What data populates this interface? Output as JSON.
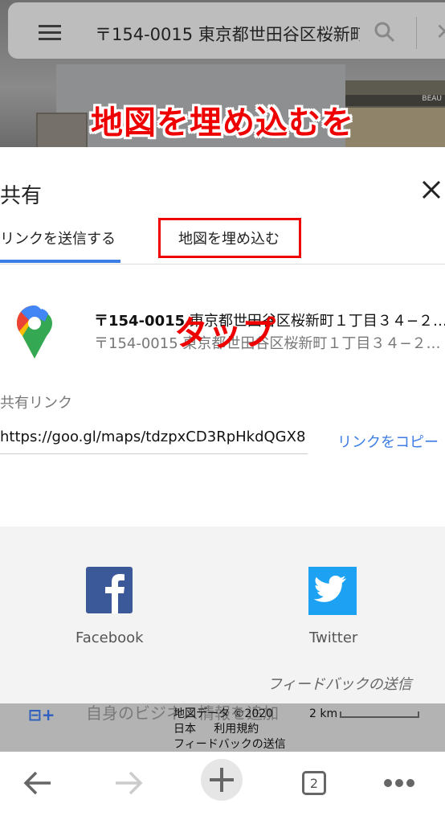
{
  "search_bar": {
    "query": "〒154-0015 東京都世田谷区桜新町",
    "icons": [
      "menu-icon",
      "search-icon",
      "close-icon"
    ]
  },
  "background": {
    "shop_sign": "BEAU"
  },
  "annotations": {
    "line1": "地図を埋め込むを",
    "line2": "タップ",
    "highlight_color": "#ee0000"
  },
  "share_sheet": {
    "title": "共有",
    "close_icon": "close-icon",
    "tabs": [
      {
        "label": "リンクを送信する",
        "active": true
      },
      {
        "label": "地図を埋め込む",
        "active": false
      }
    ],
    "accent_color": "#3b7de4",
    "place": {
      "icon": "google-maps-pin-icon",
      "title_postal": "〒154-0015",
      "title_rest": "東京都世田谷区桜新町１丁目３４−２…",
      "subtitle": "〒154-0015 東京都世田谷区桜新町１丁目３４−２…"
    },
    "share_link_label": "共有リンク",
    "share_link_value": "https://goo.gl/maps/tdzpxCD3RpHkdQGX8",
    "copy_link_label": "リンクをコピー",
    "apps": [
      {
        "name": "Facebook",
        "icon": "facebook-icon",
        "color": "#3b5998"
      },
      {
        "name": "Twitter",
        "icon": "twitter-icon",
        "color": "#1da1f2"
      }
    ],
    "feedback_label": "フィードバックの送信"
  },
  "map_footer": {
    "background_text": "自身のビジネス情報を追加",
    "map_data": "地図データ ©2020",
    "region": "日本",
    "terms": "利用規約",
    "feedback": "フィードバックの送信",
    "scale": "2 km"
  },
  "browser_nav": {
    "tab_count": "2",
    "items": [
      "back-icon",
      "forward-icon",
      "new-tab-icon",
      "tabs-icon",
      "more-icon"
    ]
  }
}
